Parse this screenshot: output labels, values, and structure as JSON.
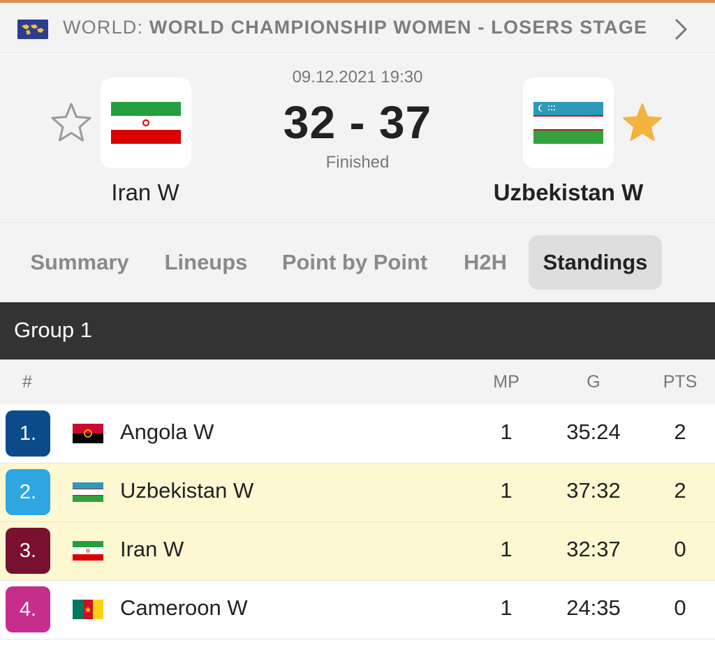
{
  "league": {
    "prefix": "WORLD: ",
    "name": "WORLD CHAMPIONSHIP WOMEN - LOSERS STAGE"
  },
  "match": {
    "datetime": "09.12.2021 19:30",
    "score": "32 - 37",
    "status": "Finished",
    "home": {
      "name": "Iran W",
      "favorite": false
    },
    "away": {
      "name": "Uzbekistan W",
      "favorite": true
    }
  },
  "tabs": [
    {
      "label": "Summary",
      "active": false
    },
    {
      "label": "Lineups",
      "active": false
    },
    {
      "label": "Point by Point",
      "active": false
    },
    {
      "label": "H2H",
      "active": false
    },
    {
      "label": "Standings",
      "active": true
    }
  ],
  "standings": {
    "group": "Group 1",
    "headers": {
      "rank": "#",
      "mp": "MP",
      "g": "G",
      "pts": "PTS"
    },
    "rows": [
      {
        "rank": "1.",
        "team": "Angola W",
        "mp": "1",
        "g": "35:24",
        "pts": "2",
        "rank_color": "#0b4b8a",
        "highlight": false
      },
      {
        "rank": "2.",
        "team": "Uzbekistan W",
        "mp": "1",
        "g": "37:32",
        "pts": "2",
        "rank_color": "#2fa6e0",
        "highlight": true
      },
      {
        "rank": "3.",
        "team": "Iran W",
        "mp": "1",
        "g": "32:37",
        "pts": "0",
        "rank_color": "#7a1030",
        "highlight": true
      },
      {
        "rank": "4.",
        "team": "Cameroon W",
        "mp": "1",
        "g": "24:35",
        "pts": "0",
        "rank_color": "#c72d8a",
        "highlight": false
      }
    ]
  },
  "colors": {
    "accent_line": "#d98f4e",
    "highlight_row": "#fdf8d2",
    "favorite_star": "#f4b23f",
    "group_bar": "#333333"
  }
}
